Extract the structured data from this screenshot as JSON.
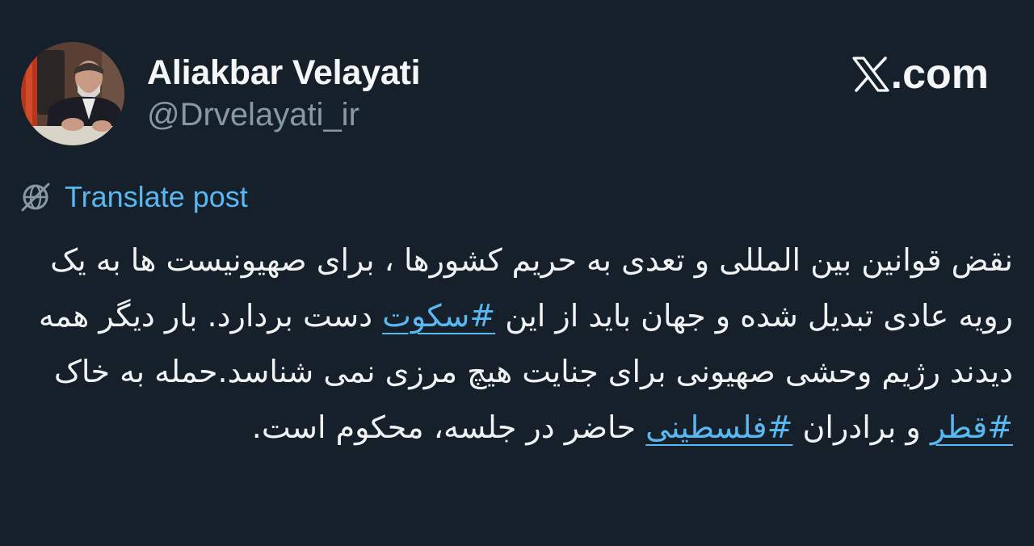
{
  "colors": {
    "background": "#16202b",
    "text": "#f1f2f3",
    "muted": "#8899a6",
    "link": "#5ab8f0"
  },
  "author": {
    "name": "Aliakbar Velayati",
    "handle": "@Drvelayati_ir",
    "avatar_icon": "profile-photo"
  },
  "brand": {
    "text": ".com",
    "icon": "x-logo-icon"
  },
  "translate": {
    "label": "Translate post",
    "icon": "globe-icon"
  },
  "post": {
    "segments": [
      "نقض قوانین بین المللی و تعدی به حریم کشورها ، برای صهیونیست ها به یک رویه عادی تبدیل شده و جهان باید از این ",
      "#سکوت",
      " دست بردارد. بار دیگر همه دیدند رژیم وحشی صهیونی برای جنایت هیچ مرزی نمی شناسد.حمله به خاک ",
      "#قطر",
      " و برادران ",
      "#فلسطینی",
      " حاضر در جلسه، محکوم است."
    ]
  }
}
